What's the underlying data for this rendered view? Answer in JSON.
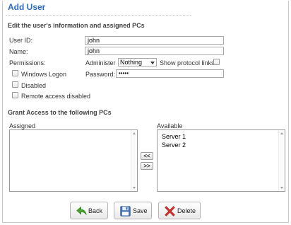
{
  "page": {
    "title": "Add User"
  },
  "user_section": {
    "heading": "Edit the user's information and assigned PCs",
    "user_id": {
      "label": "User ID:",
      "value": "john"
    },
    "name": {
      "label": "Name:",
      "value": "john"
    },
    "permissions_label": "Permissions:",
    "administer": {
      "label": "Administer",
      "selected": "Nothing"
    },
    "show_protocol_links": {
      "label": "Show protocol links",
      "checked": false
    },
    "windows_logon": {
      "label": "Windows Logon",
      "checked": false
    },
    "password": {
      "label": "Password:",
      "value": "•••••"
    },
    "disabled": {
      "label": "Disabled",
      "checked": false
    },
    "remote_access_disabled": {
      "label": "Remote access disabled",
      "checked": false
    }
  },
  "access_section": {
    "heading": "Grant Access to the following PCs",
    "assigned": {
      "label": "Assigned",
      "items": []
    },
    "available": {
      "label": "Available",
      "items": [
        "Server 1",
        "Server 2"
      ]
    },
    "move_left_label": "<<",
    "move_right_label": ">>"
  },
  "actions": {
    "back_label": "Back",
    "save_label": "Save",
    "delete_label": "Delete"
  },
  "colors": {
    "title": "#2a6bc2",
    "back_icon": "#4aa52e",
    "save_icon": "#3f6fb5",
    "delete_icon": "#d8322a"
  },
  "icons": {
    "back": "back-arrow-icon",
    "save": "floppy-disk-icon",
    "delete": "red-x-icon"
  }
}
